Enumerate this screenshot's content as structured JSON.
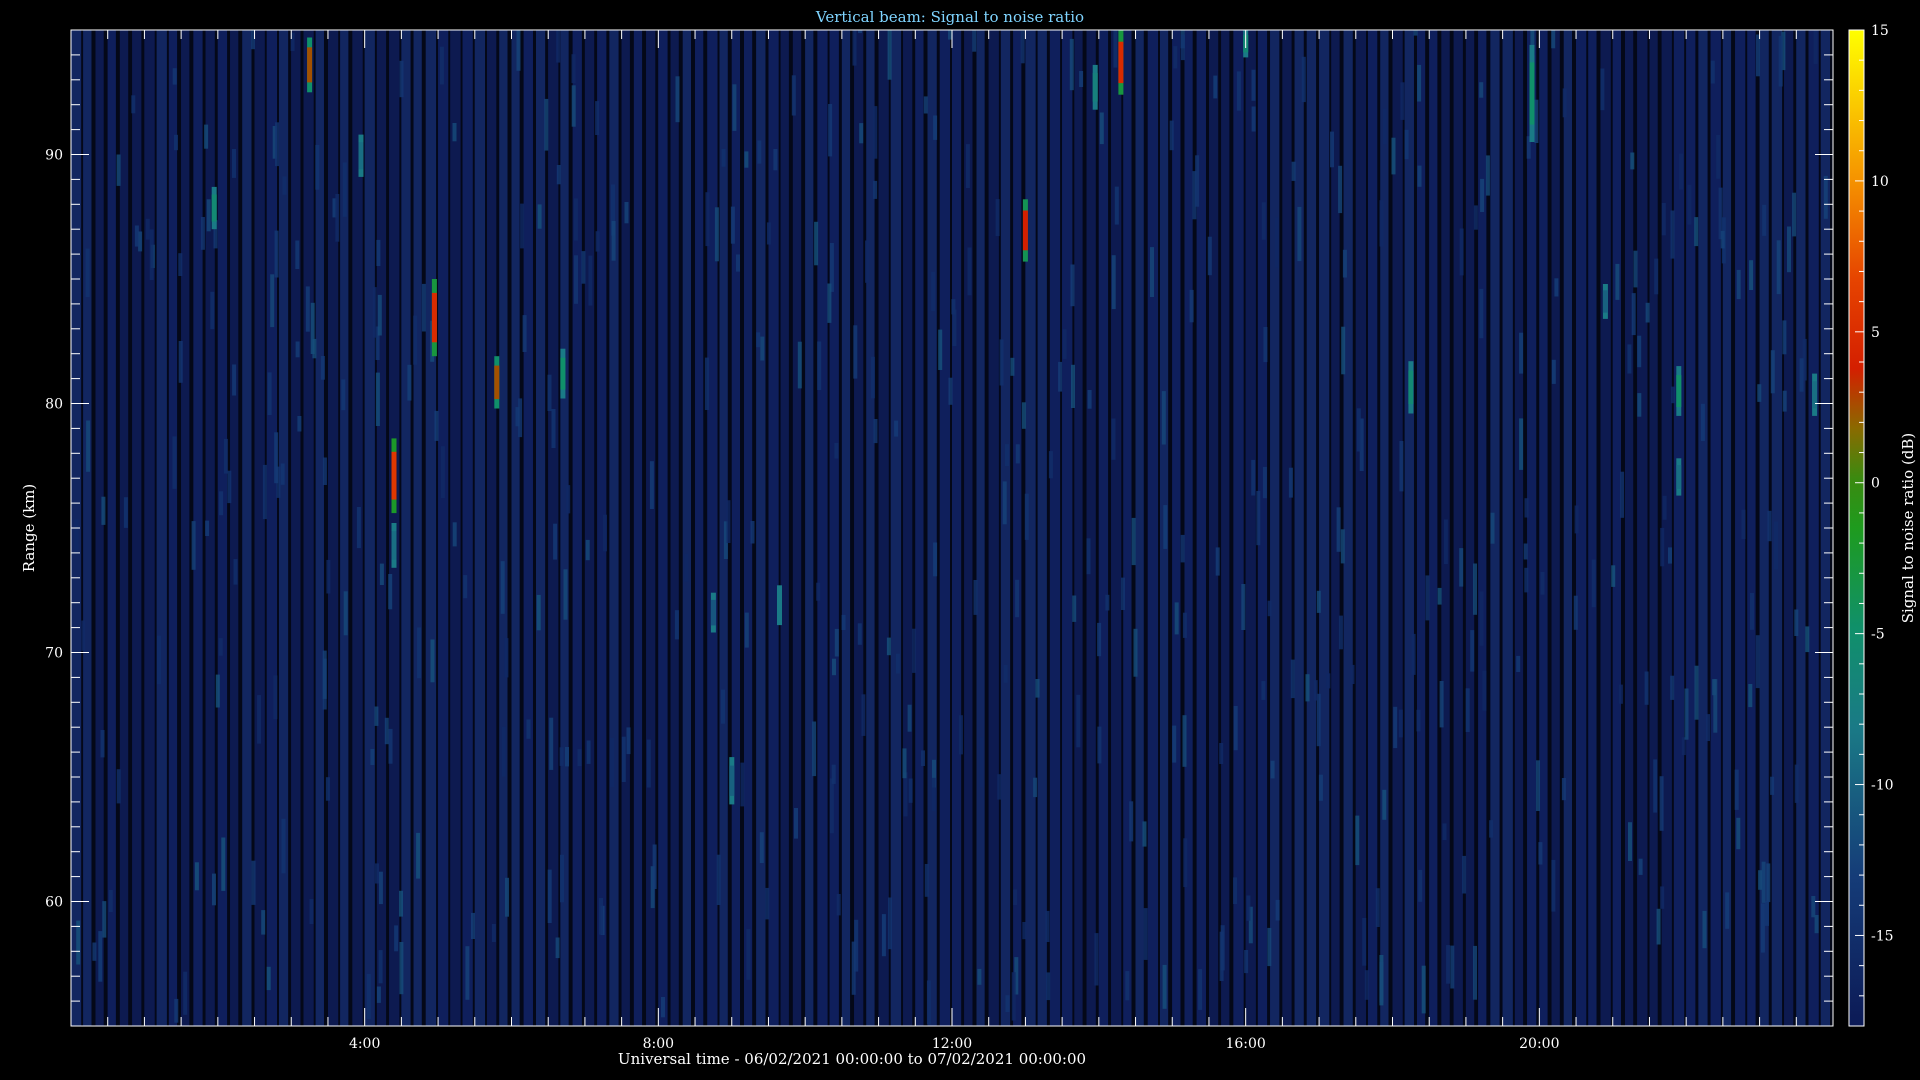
{
  "chart_data": {
    "type": "heatmap",
    "title": "Vertical beam: Signal to noise ratio",
    "xlabel": "Universal time - 06/02/2021 00:00:00 to 07/02/2021 00:00:00",
    "ylabel": "Range (km)",
    "colorbar_label": "Signal to noise ratio (dB)",
    "x_unit": "hours UT",
    "xlim": [
      0,
      24
    ],
    "ylim": [
      55,
      95
    ],
    "x_ticks": [
      {
        "value": 4,
        "label": "4:00"
      },
      {
        "value": 8,
        "label": "8:00"
      },
      {
        "value": 12,
        "label": "12:00"
      },
      {
        "value": 16,
        "label": "16:00"
      },
      {
        "value": 20,
        "label": "20:00"
      }
    ],
    "y_ticks": [
      {
        "value": 60,
        "label": "60"
      },
      {
        "value": 70,
        "label": "70"
      },
      {
        "value": 80,
        "label": "80"
      },
      {
        "value": 90,
        "label": "90"
      }
    ],
    "colorbar": {
      "range": [
        -18,
        15
      ],
      "ticks": [
        {
          "value": 15,
          "label": "15"
        },
        {
          "value": 10,
          "label": "10"
        },
        {
          "value": 5,
          "label": "5"
        },
        {
          "value": 0,
          "label": "0"
        },
        {
          "value": -5,
          "label": "-5"
        },
        {
          "value": -10,
          "label": "-10"
        },
        {
          "value": -15,
          "label": "-15"
        }
      ]
    },
    "background_snr_db": -16,
    "echoes": [
      {
        "time": 3.25,
        "range_min": 92.5,
        "range_max": 94.7,
        "snr_db": 1
      },
      {
        "time": 3.95,
        "range_min": 89.1,
        "range_max": 90.8,
        "snr_db": -9
      },
      {
        "time": 1.95,
        "range_min": 87.0,
        "range_max": 88.7,
        "snr_db": -6
      },
      {
        "time": 4.4,
        "range_min": 75.6,
        "range_max": 78.6,
        "snr_db": 4
      },
      {
        "time": 4.4,
        "range_min": 73.4,
        "range_max": 75.2,
        "snr_db": -9
      },
      {
        "time": 4.95,
        "range_min": 81.9,
        "range_max": 85.0,
        "snr_db": 3
      },
      {
        "time": 5.8,
        "range_min": 79.8,
        "range_max": 81.9,
        "snr_db": 1
      },
      {
        "time": 6.7,
        "range_min": 80.2,
        "range_max": 82.2,
        "snr_db": -5
      },
      {
        "time": 8.75,
        "range_min": 70.8,
        "range_max": 72.4,
        "snr_db": -11
      },
      {
        "time": 9.65,
        "range_min": 71.1,
        "range_max": 72.7,
        "snr_db": -8
      },
      {
        "time": 9.0,
        "range_min": 63.9,
        "range_max": 65.8,
        "snr_db": -10
      },
      {
        "time": 13.0,
        "range_min": 85.7,
        "range_max": 88.2,
        "snr_db": 2
      },
      {
        "time": 13.95,
        "range_min": 91.8,
        "range_max": 93.6,
        "snr_db": -7
      },
      {
        "time": 14.3,
        "range_min": 92.4,
        "range_max": 95.0,
        "snr_db": 3
      },
      {
        "time": 16.0,
        "range_min": 93.9,
        "range_max": 95.0,
        "snr_db": -6
      },
      {
        "time": 18.25,
        "range_min": 79.6,
        "range_max": 81.7,
        "snr_db": -6
      },
      {
        "time": 19.9,
        "range_min": 90.5,
        "range_max": 94.4,
        "snr_db": -5
      },
      {
        "time": 20.9,
        "range_min": 83.4,
        "range_max": 84.8,
        "snr_db": -10
      },
      {
        "time": 21.9,
        "range_min": 79.5,
        "range_max": 81.5,
        "snr_db": -5
      },
      {
        "time": 21.9,
        "range_min": 76.3,
        "range_max": 77.8,
        "snr_db": -9
      },
      {
        "time": 23.75,
        "range_min": 79.5,
        "range_max": 81.2,
        "snr_db": -9
      }
    ]
  }
}
